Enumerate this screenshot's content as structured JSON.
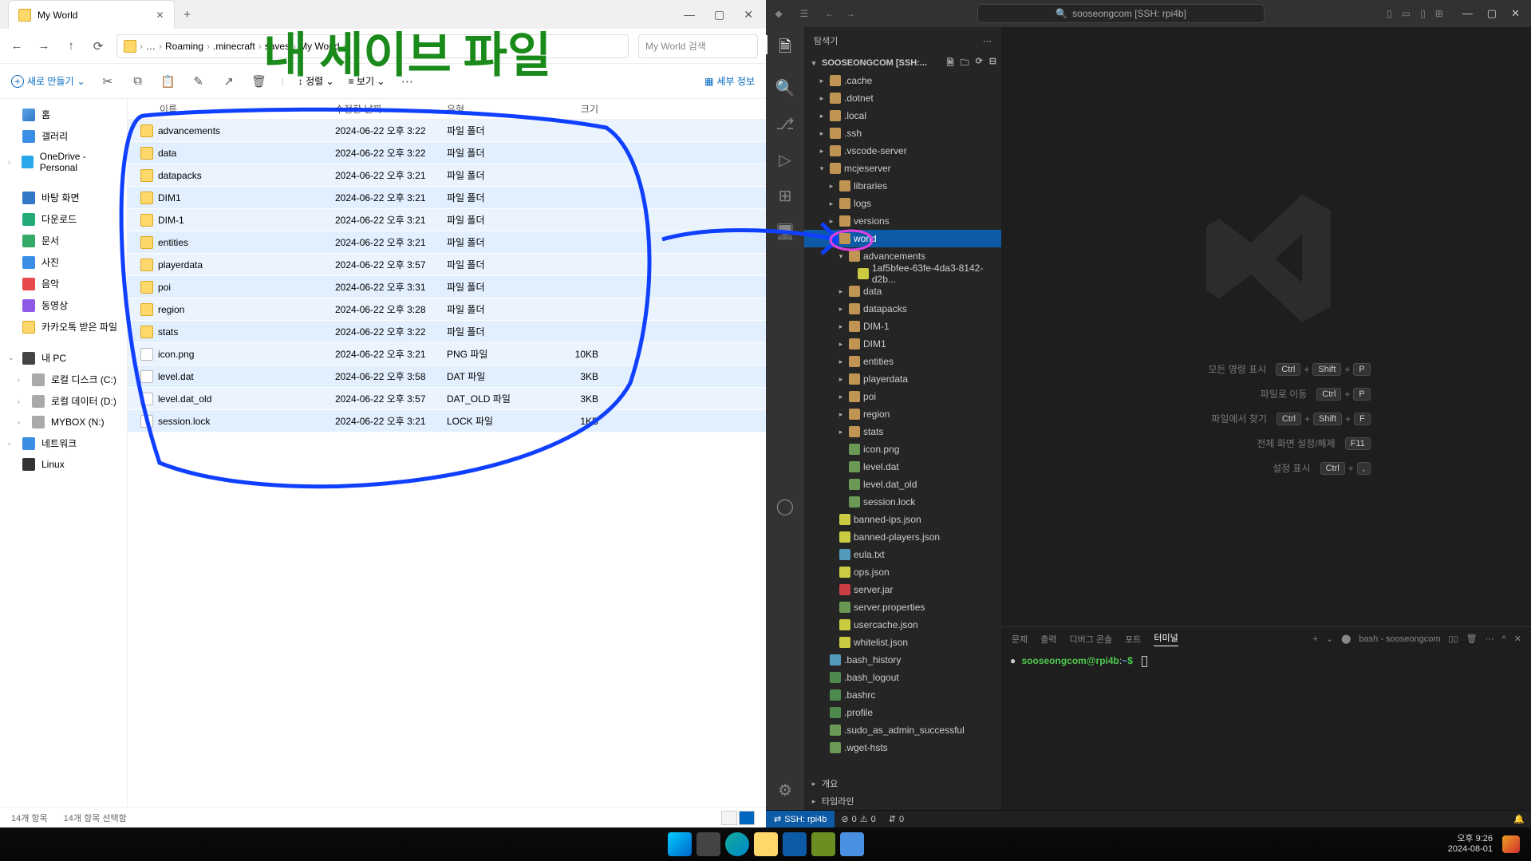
{
  "explorer": {
    "tab_title": "My World",
    "window_controls": {
      "min": "—",
      "max": "▢",
      "close": "✕"
    },
    "nav": {
      "back": "←",
      "fwd": "→",
      "up": "↑",
      "refresh": "⟳",
      "more": "…"
    },
    "breadcrumbs": [
      "Roaming",
      ".minecraft",
      "saves",
      "My World"
    ],
    "search_placeholder": "My World 검색",
    "toolbar": {
      "new_label": "새로 만들기",
      "sort_label": "정렬",
      "view_label": "보기",
      "details_label": "세부 정보"
    },
    "side_items": [
      {
        "label": "홈",
        "cls": "s-home"
      },
      {
        "label": "갤러리",
        "cls": "s-gallery"
      },
      {
        "label": "OneDrive - Personal",
        "cls": "s-onedrive",
        "chev": true
      },
      {
        "sep": true
      },
      {
        "label": "바탕 화면",
        "cls": "s-desktop"
      },
      {
        "label": "다운로드",
        "cls": "s-down"
      },
      {
        "label": "문서",
        "cls": "s-doc"
      },
      {
        "label": "사진",
        "cls": "s-pic"
      },
      {
        "label": "음악",
        "cls": "s-music"
      },
      {
        "label": "동영상",
        "cls": "s-video"
      },
      {
        "label": "카카오톡 받은 파일",
        "cls": "s-kakao"
      },
      {
        "sep": true
      },
      {
        "label": "내 PC",
        "cls": "s-pc",
        "chev": true,
        "open": true
      },
      {
        "label": "로컬 디스크 (C:)",
        "cls": "s-disk",
        "sub": true,
        "chev": true
      },
      {
        "label": "로컬 데이터 (D:)",
        "cls": "s-disk",
        "sub": true,
        "chev": true
      },
      {
        "label": "MYBOX (N:)",
        "cls": "s-disk",
        "sub": true,
        "chev": true
      },
      {
        "label": "네트워크",
        "cls": "s-net",
        "chev": true
      },
      {
        "label": "Linux",
        "cls": "s-linux"
      }
    ],
    "columns": {
      "name": "이름",
      "date": "수정한 날짜",
      "type": "유형",
      "size": "크기"
    },
    "files": [
      {
        "name": "advancements",
        "date": "2024-06-22 오후 3:22",
        "type": "파일 폴더",
        "size": "",
        "folder": true
      },
      {
        "name": "data",
        "date": "2024-06-22 오후 3:22",
        "type": "파일 폴더",
        "size": "",
        "folder": true
      },
      {
        "name": "datapacks",
        "date": "2024-06-22 오후 3:21",
        "type": "파일 폴더",
        "size": "",
        "folder": true
      },
      {
        "name": "DIM1",
        "date": "2024-06-22 오후 3:21",
        "type": "파일 폴더",
        "size": "",
        "folder": true
      },
      {
        "name": "DIM-1",
        "date": "2024-06-22 오후 3:21",
        "type": "파일 폴더",
        "size": "",
        "folder": true
      },
      {
        "name": "entities",
        "date": "2024-06-22 오후 3:21",
        "type": "파일 폴더",
        "size": "",
        "folder": true
      },
      {
        "name": "playerdata",
        "date": "2024-06-22 오후 3:57",
        "type": "파일 폴더",
        "size": "",
        "folder": true
      },
      {
        "name": "poi",
        "date": "2024-06-22 오후 3:31",
        "type": "파일 폴더",
        "size": "",
        "folder": true
      },
      {
        "name": "region",
        "date": "2024-06-22 오후 3:28",
        "type": "파일 폴더",
        "size": "",
        "folder": true
      },
      {
        "name": "stats",
        "date": "2024-06-22 오후 3:22",
        "type": "파일 폴더",
        "size": "",
        "folder": true
      },
      {
        "name": "icon.png",
        "date": "2024-06-22 오후 3:21",
        "type": "PNG 파일",
        "size": "10KB",
        "folder": false
      },
      {
        "name": "level.dat",
        "date": "2024-06-22 오후 3:58",
        "type": "DAT 파일",
        "size": "3KB",
        "folder": false
      },
      {
        "name": "level.dat_old",
        "date": "2024-06-22 오후 3:57",
        "type": "DAT_OLD 파일",
        "size": "3KB",
        "folder": false
      },
      {
        "name": "session.lock",
        "date": "2024-06-22 오후 3:21",
        "type": "LOCK 파일",
        "size": "1KB",
        "folder": false
      }
    ],
    "status": {
      "count": "14개 항목",
      "selected": "14개 항목 선택함"
    }
  },
  "annotation": {
    "title_text": "내 세이브 파일"
  },
  "vscode": {
    "title_search": "sooseongcom [SSH: rpi4b]",
    "sidebar_title": "탐색기",
    "root_label": "SOOSEONGCOM [SSH:...",
    "tree": [
      {
        "d": 1,
        "l": ".cache",
        "ic": "folder",
        "c": "closed"
      },
      {
        "d": 1,
        "l": ".dotnet",
        "ic": "folder",
        "c": "closed"
      },
      {
        "d": 1,
        "l": ".local",
        "ic": "folder",
        "c": "closed"
      },
      {
        "d": 1,
        "l": ".ssh",
        "ic": "folder",
        "c": "closed"
      },
      {
        "d": 1,
        "l": ".vscode-server",
        "ic": "folder",
        "c": "closed"
      },
      {
        "d": 1,
        "l": "mcjeserver",
        "ic": "folder",
        "c": "open"
      },
      {
        "d": 2,
        "l": "libraries",
        "ic": "folder",
        "c": "closed"
      },
      {
        "d": 2,
        "l": "logs",
        "ic": "folder",
        "c": "closed"
      },
      {
        "d": 2,
        "l": "versions",
        "ic": "folder",
        "c": "closed"
      },
      {
        "d": 2,
        "l": "world",
        "ic": "folder",
        "c": "open",
        "sel": true
      },
      {
        "d": 3,
        "l": "advancements",
        "ic": "folder",
        "c": "open"
      },
      {
        "d": 4,
        "l": "1af5bfee-63fe-4da3-8142-d2b...",
        "ic": "json",
        "c": "none"
      },
      {
        "d": 3,
        "l": "data",
        "ic": "folder",
        "c": "closed"
      },
      {
        "d": 3,
        "l": "datapacks",
        "ic": "folder",
        "c": "closed"
      },
      {
        "d": 3,
        "l": "DIM-1",
        "ic": "folder",
        "c": "closed"
      },
      {
        "d": 3,
        "l": "DIM1",
        "ic": "folder",
        "c": "closed"
      },
      {
        "d": 3,
        "l": "entities",
        "ic": "folder",
        "c": "closed"
      },
      {
        "d": 3,
        "l": "playerdata",
        "ic": "folder",
        "c": "closed"
      },
      {
        "d": 3,
        "l": "poi",
        "ic": "folder",
        "c": "closed"
      },
      {
        "d": 3,
        "l": "region",
        "ic": "folder",
        "c": "closed"
      },
      {
        "d": 3,
        "l": "stats",
        "ic": "folder",
        "c": "closed"
      },
      {
        "d": 3,
        "l": "icon.png",
        "ic": "file",
        "c": "none"
      },
      {
        "d": 3,
        "l": "level.dat",
        "ic": "file",
        "c": "none"
      },
      {
        "d": 3,
        "l": "level.dat_old",
        "ic": "file",
        "c": "none"
      },
      {
        "d": 3,
        "l": "session.lock",
        "ic": "file",
        "c": "none"
      },
      {
        "d": 2,
        "l": "banned-ips.json",
        "ic": "json",
        "c": "none"
      },
      {
        "d": 2,
        "l": "banned-players.json",
        "ic": "json",
        "c": "none"
      },
      {
        "d": 2,
        "l": "eula.txt",
        "ic": "txt",
        "c": "none"
      },
      {
        "d": 2,
        "l": "ops.json",
        "ic": "json",
        "c": "none"
      },
      {
        "d": 2,
        "l": "server.jar",
        "ic": "jar",
        "c": "none"
      },
      {
        "d": 2,
        "l": "server.properties",
        "ic": "file",
        "c": "none"
      },
      {
        "d": 2,
        "l": "usercache.json",
        "ic": "json",
        "c": "none"
      },
      {
        "d": 2,
        "l": "whitelist.json",
        "ic": "json",
        "c": "none"
      },
      {
        "d": 1,
        "l": ".bash_history",
        "ic": "txt",
        "c": "none"
      },
      {
        "d": 1,
        "l": ".bash_logout",
        "ic": "dollar",
        "c": "none"
      },
      {
        "d": 1,
        "l": ".bashrc",
        "ic": "dollar",
        "c": "none"
      },
      {
        "d": 1,
        "l": ".profile",
        "ic": "dollar",
        "c": "none"
      },
      {
        "d": 1,
        "l": ".sudo_as_admin_successful",
        "ic": "file",
        "c": "none"
      },
      {
        "d": 1,
        "l": ".wget-hsts",
        "ic": "file",
        "c": "none"
      }
    ],
    "side_footer": {
      "outline": "개요",
      "timeline": "타임라인"
    },
    "shortcuts": [
      {
        "label": "모든 명령 표시",
        "keys": [
          "Ctrl",
          "+",
          "Shift",
          "+",
          "P"
        ]
      },
      {
        "label": "파일로 이동",
        "keys": [
          "Ctrl",
          "+",
          "P"
        ]
      },
      {
        "label": "파일에서 찾기",
        "keys": [
          "Ctrl",
          "+",
          "Shift",
          "+",
          "F"
        ]
      },
      {
        "label": "전체 화면 설정/해제",
        "keys": [
          "F11"
        ]
      },
      {
        "label": "설정 표시",
        "keys": [
          "Ctrl",
          "+",
          ","
        ]
      }
    ],
    "panel_tabs": {
      "problems": "문제",
      "output": "출력",
      "debug": "디버그 콘솔",
      "ports": "포트",
      "terminal": "터미널"
    },
    "term_shell": "bash - sooseongcom",
    "term_prompt": {
      "user": "sooseongcom@rpi4b",
      "path": "~",
      "sep": ":",
      "suffix": "$"
    },
    "status": {
      "ssh": "SSH: rpi4b",
      "errors": "0",
      "warnings": "0",
      "ports": "0"
    }
  },
  "taskbar": {
    "time": "오후 9:26",
    "date": "2024-08-01"
  }
}
